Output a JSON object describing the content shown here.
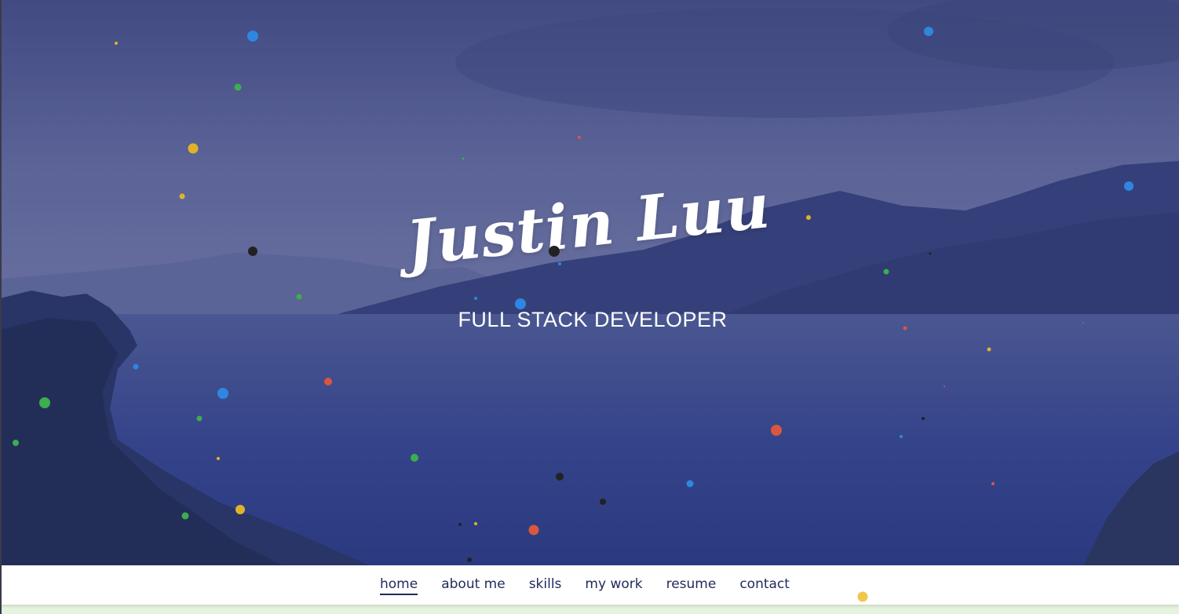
{
  "hero": {
    "name": "Justin Luu",
    "subtitle": "FULL STACK DEVELOPER"
  },
  "nav": {
    "items": [
      {
        "label": "home",
        "active": true
      },
      {
        "label": "about me",
        "active": false
      },
      {
        "label": "skills",
        "active": false
      },
      {
        "label": "my work",
        "active": false
      },
      {
        "label": "resume",
        "active": false
      },
      {
        "label": "contact",
        "active": false
      }
    ]
  },
  "colors": {
    "nav_text": "#1f2a5c",
    "particle_blue": "#2f86e0",
    "particle_green": "#3cae4e",
    "particle_yellow": "#e0b22a",
    "particle_red": "#d9573e",
    "particle_dark": "#222222"
  }
}
